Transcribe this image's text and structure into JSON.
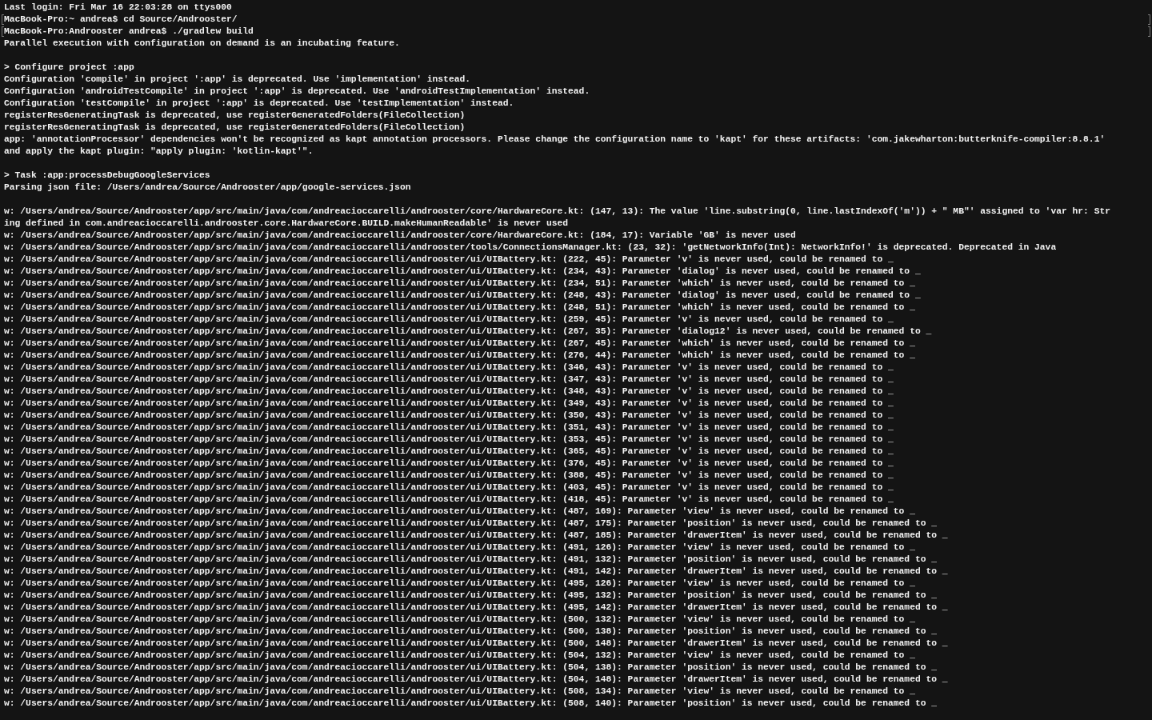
{
  "terminal": {
    "blocks": [
      {
        "lines": [
          {
            "kind": "output",
            "text": "Last login: Fri Mar 16 22:03:28 on ttys000"
          },
          {
            "kind": "prompt",
            "text": "MacBook-Pro:~ andrea$ cd Source/Androoster/"
          },
          {
            "kind": "prompt",
            "text": "MacBook-Pro:Androoster andrea$ ./gradlew build"
          },
          {
            "kind": "output",
            "text": "Parallel execution with configuration on demand is an incubating feature."
          }
        ]
      },
      {
        "lines": [
          {
            "kind": "output",
            "text": "> Configure project :app"
          },
          {
            "kind": "output",
            "text": "Configuration 'compile' in project ':app' is deprecated. Use 'implementation' instead."
          },
          {
            "kind": "output",
            "text": "Configuration 'androidTestCompile' in project ':app' is deprecated. Use 'androidTestImplementation' instead."
          },
          {
            "kind": "output",
            "text": "Configuration 'testCompile' in project ':app' is deprecated. Use 'testImplementation' instead."
          },
          {
            "kind": "output",
            "text": "registerResGeneratingTask is deprecated, use registerGeneratedFolders(FileCollection)"
          },
          {
            "kind": "output",
            "text": "registerResGeneratingTask is deprecated, use registerGeneratedFolders(FileCollection)"
          },
          {
            "kind": "output",
            "text": "app: 'annotationProcessor' dependencies won't be recognized as kapt annotation processors. Please change the configuration name to 'kapt' for these artifacts: 'com.jakewharton:butterknife-compiler:8.8.1'"
          },
          {
            "kind": "output",
            "text": "and apply the kapt plugin: \"apply plugin: 'kotlin-kapt'\"."
          }
        ]
      },
      {
        "lines": [
          {
            "kind": "output",
            "text": "> Task :app:processDebugGoogleServices"
          },
          {
            "kind": "output",
            "text": "Parsing json file: /Users/andrea/Source/Androoster/app/google-services.json"
          }
        ]
      },
      {
        "lines": [
          {
            "kind": "output",
            "text": "w: /Users/andrea/Source/Androoster/app/src/main/java/com/andreacioccarelli/androoster/core/HardwareCore.kt: (147, 13): The value 'line.substring(0, line.lastIndexOf('m')) + \" MB\"' assigned to 'var hr: Str"
          },
          {
            "kind": "output",
            "text": "ing defined in com.andreacioccarelli.androoster.core.HardwareCore.BUILD.makeHumanReadable' is never used"
          },
          {
            "kind": "output",
            "text": "w: /Users/andrea/Source/Androoster/app/src/main/java/com/andreacioccarelli/androoster/core/HardwareCore.kt: (184, 17): Variable 'GB' is never used"
          },
          {
            "kind": "output",
            "text": "w: /Users/andrea/Source/Androoster/app/src/main/java/com/andreacioccarelli/androoster/tools/ConnectionsManager.kt: (23, 32): 'getNetworkInfo(Int): NetworkInfo!' is deprecated. Deprecated in Java"
          },
          {
            "kind": "output",
            "text": "w: /Users/andrea/Source/Androoster/app/src/main/java/com/andreacioccarelli/androoster/ui/UIBattery.kt: (222, 45): Parameter 'v' is never used, could be renamed to _"
          },
          {
            "kind": "output",
            "text": "w: /Users/andrea/Source/Androoster/app/src/main/java/com/andreacioccarelli/androoster/ui/UIBattery.kt: (234, 43): Parameter 'dialog' is never used, could be renamed to _"
          },
          {
            "kind": "output",
            "text": "w: /Users/andrea/Source/Androoster/app/src/main/java/com/andreacioccarelli/androoster/ui/UIBattery.kt: (234, 51): Parameter 'which' is never used, could be renamed to _"
          },
          {
            "kind": "output",
            "text": "w: /Users/andrea/Source/Androoster/app/src/main/java/com/andreacioccarelli/androoster/ui/UIBattery.kt: (248, 43): Parameter 'dialog' is never used, could be renamed to _"
          },
          {
            "kind": "output",
            "text": "w: /Users/andrea/Source/Androoster/app/src/main/java/com/andreacioccarelli/androoster/ui/UIBattery.kt: (248, 51): Parameter 'which' is never used, could be renamed to _"
          },
          {
            "kind": "output",
            "text": "w: /Users/andrea/Source/Androoster/app/src/main/java/com/andreacioccarelli/androoster/ui/UIBattery.kt: (259, 45): Parameter 'v' is never used, could be renamed to _"
          },
          {
            "kind": "output",
            "text": "w: /Users/andrea/Source/Androoster/app/src/main/java/com/andreacioccarelli/androoster/ui/UIBattery.kt: (267, 35): Parameter 'dialog12' is never used, could be renamed to _"
          },
          {
            "kind": "output",
            "text": "w: /Users/andrea/Source/Androoster/app/src/main/java/com/andreacioccarelli/androoster/ui/UIBattery.kt: (267, 45): Parameter 'which' is never used, could be renamed to _"
          },
          {
            "kind": "output",
            "text": "w: /Users/andrea/Source/Androoster/app/src/main/java/com/andreacioccarelli/androoster/ui/UIBattery.kt: (276, 44): Parameter 'which' is never used, could be renamed to _"
          },
          {
            "kind": "output",
            "text": "w: /Users/andrea/Source/Androoster/app/src/main/java/com/andreacioccarelli/androoster/ui/UIBattery.kt: (346, 43): Parameter 'v' is never used, could be renamed to _"
          },
          {
            "kind": "output",
            "text": "w: /Users/andrea/Source/Androoster/app/src/main/java/com/andreacioccarelli/androoster/ui/UIBattery.kt: (347, 43): Parameter 'v' is never used, could be renamed to _"
          },
          {
            "kind": "output",
            "text": "w: /Users/andrea/Source/Androoster/app/src/main/java/com/andreacioccarelli/androoster/ui/UIBattery.kt: (348, 43): Parameter 'v' is never used, could be renamed to _"
          },
          {
            "kind": "output",
            "text": "w: /Users/andrea/Source/Androoster/app/src/main/java/com/andreacioccarelli/androoster/ui/UIBattery.kt: (349, 43): Parameter 'v' is never used, could be renamed to _"
          },
          {
            "kind": "output",
            "text": "w: /Users/andrea/Source/Androoster/app/src/main/java/com/andreacioccarelli/androoster/ui/UIBattery.kt: (350, 43): Parameter 'v' is never used, could be renamed to _"
          },
          {
            "kind": "output",
            "text": "w: /Users/andrea/Source/Androoster/app/src/main/java/com/andreacioccarelli/androoster/ui/UIBattery.kt: (351, 43): Parameter 'v' is never used, could be renamed to _"
          },
          {
            "kind": "output",
            "text": "w: /Users/andrea/Source/Androoster/app/src/main/java/com/andreacioccarelli/androoster/ui/UIBattery.kt: (353, 45): Parameter 'v' is never used, could be renamed to _"
          },
          {
            "kind": "output",
            "text": "w: /Users/andrea/Source/Androoster/app/src/main/java/com/andreacioccarelli/androoster/ui/UIBattery.kt: (365, 45): Parameter 'v' is never used, could be renamed to _"
          },
          {
            "kind": "output",
            "text": "w: /Users/andrea/Source/Androoster/app/src/main/java/com/andreacioccarelli/androoster/ui/UIBattery.kt: (376, 45): Parameter 'v' is never used, could be renamed to _"
          },
          {
            "kind": "output",
            "text": "w: /Users/andrea/Source/Androoster/app/src/main/java/com/andreacioccarelli/androoster/ui/UIBattery.kt: (388, 45): Parameter 'v' is never used, could be renamed to _"
          },
          {
            "kind": "output",
            "text": "w: /Users/andrea/Source/Androoster/app/src/main/java/com/andreacioccarelli/androoster/ui/UIBattery.kt: (403, 45): Parameter 'v' is never used, could be renamed to _"
          },
          {
            "kind": "output",
            "text": "w: /Users/andrea/Source/Androoster/app/src/main/java/com/andreacioccarelli/androoster/ui/UIBattery.kt: (418, 45): Parameter 'v' is never used, could be renamed to _"
          },
          {
            "kind": "output",
            "text": "w: /Users/andrea/Source/Androoster/app/src/main/java/com/andreacioccarelli/androoster/ui/UIBattery.kt: (487, 169): Parameter 'view' is never used, could be renamed to _"
          },
          {
            "kind": "output",
            "text": "w: /Users/andrea/Source/Androoster/app/src/main/java/com/andreacioccarelli/androoster/ui/UIBattery.kt: (487, 175): Parameter 'position' is never used, could be renamed to _"
          },
          {
            "kind": "output",
            "text": "w: /Users/andrea/Source/Androoster/app/src/main/java/com/andreacioccarelli/androoster/ui/UIBattery.kt: (487, 185): Parameter 'drawerItem' is never used, could be renamed to _"
          },
          {
            "kind": "output",
            "text": "w: /Users/andrea/Source/Androoster/app/src/main/java/com/andreacioccarelli/androoster/ui/UIBattery.kt: (491, 126): Parameter 'view' is never used, could be renamed to _"
          },
          {
            "kind": "output",
            "text": "w: /Users/andrea/Source/Androoster/app/src/main/java/com/andreacioccarelli/androoster/ui/UIBattery.kt: (491, 132): Parameter 'position' is never used, could be renamed to _"
          },
          {
            "kind": "output",
            "text": "w: /Users/andrea/Source/Androoster/app/src/main/java/com/andreacioccarelli/androoster/ui/UIBattery.kt: (491, 142): Parameter 'drawerItem' is never used, could be renamed to _"
          },
          {
            "kind": "output",
            "text": "w: /Users/andrea/Source/Androoster/app/src/main/java/com/andreacioccarelli/androoster/ui/UIBattery.kt: (495, 126): Parameter 'view' is never used, could be renamed to _"
          },
          {
            "kind": "output",
            "text": "w: /Users/andrea/Source/Androoster/app/src/main/java/com/andreacioccarelli/androoster/ui/UIBattery.kt: (495, 132): Parameter 'position' is never used, could be renamed to _"
          },
          {
            "kind": "output",
            "text": "w: /Users/andrea/Source/Androoster/app/src/main/java/com/andreacioccarelli/androoster/ui/UIBattery.kt: (495, 142): Parameter 'drawerItem' is never used, could be renamed to _"
          },
          {
            "kind": "output",
            "text": "w: /Users/andrea/Source/Androoster/app/src/main/java/com/andreacioccarelli/androoster/ui/UIBattery.kt: (500, 132): Parameter 'view' is never used, could be renamed to _"
          },
          {
            "kind": "output",
            "text": "w: /Users/andrea/Source/Androoster/app/src/main/java/com/andreacioccarelli/androoster/ui/UIBattery.kt: (500, 138): Parameter 'position' is never used, could be renamed to _"
          },
          {
            "kind": "output",
            "text": "w: /Users/andrea/Source/Androoster/app/src/main/java/com/andreacioccarelli/androoster/ui/UIBattery.kt: (500, 148): Parameter 'drawerItem' is never used, could be renamed to _"
          },
          {
            "kind": "output",
            "text": "w: /Users/andrea/Source/Androoster/app/src/main/java/com/andreacioccarelli/androoster/ui/UIBattery.kt: (504, 132): Parameter 'view' is never used, could be renamed to _"
          },
          {
            "kind": "output",
            "text": "w: /Users/andrea/Source/Androoster/app/src/main/java/com/andreacioccarelli/androoster/ui/UIBattery.kt: (504, 138): Parameter 'position' is never used, could be renamed to _"
          },
          {
            "kind": "output",
            "text": "w: /Users/andrea/Source/Androoster/app/src/main/java/com/andreacioccarelli/androoster/ui/UIBattery.kt: (504, 148): Parameter 'drawerItem' is never used, could be renamed to _"
          },
          {
            "kind": "output",
            "text": "w: /Users/andrea/Source/Androoster/app/src/main/java/com/andreacioccarelli/androoster/ui/UIBattery.kt: (508, 134): Parameter 'view' is never used, could be renamed to _"
          },
          {
            "kind": "output",
            "text": "w: /Users/andrea/Source/Androoster/app/src/main/java/com/andreacioccarelli/androoster/ui/UIBattery.kt: (508, 140): Parameter 'position' is never used, could be renamed to _"
          }
        ]
      }
    ]
  }
}
